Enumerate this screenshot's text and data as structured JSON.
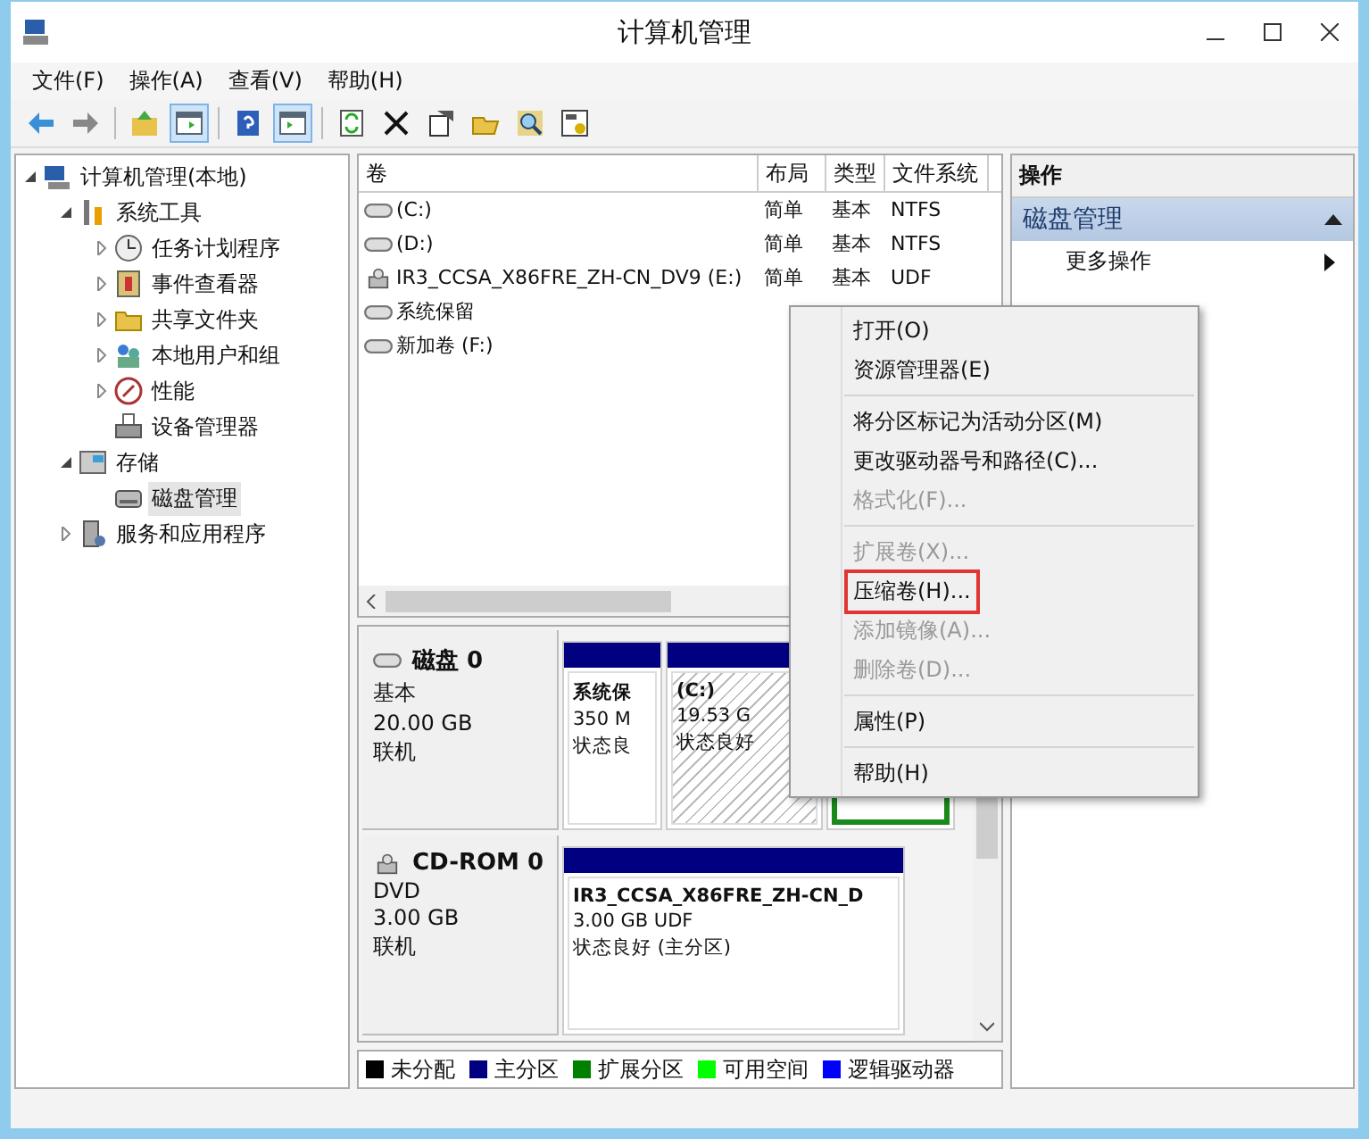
{
  "window": {
    "title": "计算机管理"
  },
  "menu_bar": [
    "文件(F)",
    "操作(A)",
    "查看(V)",
    "帮助(H)"
  ],
  "toolbar": [
    {
      "kind": "back"
    },
    {
      "kind": "forward"
    },
    {
      "kind": "separator"
    },
    {
      "kind": "up"
    },
    {
      "kind": "tree",
      "pressed": true
    },
    {
      "kind": "separator"
    },
    {
      "kind": "help"
    },
    {
      "kind": "pane",
      "pressed": true
    },
    {
      "kind": "separator"
    },
    {
      "kind": "refresh"
    },
    {
      "kind": "delete"
    },
    {
      "kind": "properties"
    },
    {
      "kind": "open"
    },
    {
      "kind": "find"
    },
    {
      "kind": "settings"
    }
  ],
  "tree": [
    {
      "label": "计算机管理(本地)",
      "kind": "computer",
      "expanded": true,
      "selected": false,
      "children": [
        {
          "label": "系统工具",
          "kind": "tools",
          "expanded": true,
          "selected": false,
          "children": [
            {
              "label": "任务计划程序",
              "kind": "clock",
              "expanded": false,
              "selected": false
            },
            {
              "label": "事件查看器",
              "kind": "log",
              "expanded": false,
              "selected": false
            },
            {
              "label": "共享文件夹",
              "kind": "folder",
              "expanded": false,
              "selected": false
            },
            {
              "label": "本地用户和组",
              "kind": "users",
              "expanded": false,
              "selected": false
            },
            {
              "label": "性能",
              "kind": "gauge",
              "expanded": false,
              "selected": false
            },
            {
              "label": "设备管理器",
              "kind": "device",
              "selected": false
            }
          ]
        },
        {
          "label": "存储",
          "kind": "storage",
          "expanded": true,
          "selected": false,
          "children": [
            {
              "label": "磁盘管理",
              "kind": "disk",
              "selected": true
            }
          ]
        },
        {
          "label": "服务和应用程序",
          "kind": "services",
          "expanded": false,
          "selected": false
        }
      ]
    }
  ],
  "volumes": {
    "columns": [
      "卷",
      "布局",
      "类型",
      "文件系统"
    ],
    "rows": [
      {
        "kind": "disk",
        "volume": "(C:)",
        "layout": "简单",
        "type": "基本",
        "file_system": "NTFS"
      },
      {
        "kind": "disk",
        "volume": "(D:)",
        "layout": "简单",
        "type": "基本",
        "file_system": "NTFS"
      },
      {
        "kind": "cd",
        "volume": "IR3_CCSA_X86FRE_ZH-CN_DV9 (E:)",
        "layout": "简单",
        "type": "基本",
        "file_system": "UDF"
      },
      {
        "kind": "disk",
        "volume": "系统保留"
      },
      {
        "kind": "disk",
        "volume": "新加卷 (F:)"
      }
    ]
  },
  "actions": {
    "title": "操作",
    "section": "磁盘管理",
    "expanded": true,
    "items": [
      "更多操作"
    ]
  },
  "disks": [
    {
      "kind": "disk",
      "name": "磁盘 0",
      "lines": [
        "基本",
        "20.00 GB",
        "联机"
      ],
      "partitions": [
        {
          "kind": "primary",
          "name": "系统保",
          "lines": [
            "350 M",
            "状态良"
          ],
          "selected": false
        },
        {
          "kind": "primary",
          "name": "(C:)",
          "lines": [
            "19.53 G",
            "状态良好"
          ],
          "selected": true
        },
        {
          "kind": "extended",
          "selected": false
        }
      ]
    },
    {
      "kind": "cd",
      "name": "CD-ROM 0",
      "lines": [
        "DVD",
        "3.00 GB",
        "联机"
      ],
      "partitions": [
        {
          "kind": "primary",
          "name": "IR3_CCSA_X86FRE_ZH-CN_D",
          "lines": [
            "3.00 GB UDF",
            "状态良好 (主分区)"
          ],
          "selected": false
        }
      ]
    }
  ],
  "legend": [
    {
      "label": "未分配",
      "color": "#000000"
    },
    {
      "label": "主分区",
      "color": "#000080"
    },
    {
      "label": "扩展分区",
      "color": "#008000"
    },
    {
      "label": "可用空间",
      "color": "#00ff00"
    },
    {
      "label": "逻辑驱动器",
      "color": "#0000ff"
    }
  ],
  "context_menu": [
    {
      "kind": "item",
      "label": "打开(O)",
      "disabled": false,
      "highlighted": false
    },
    {
      "kind": "item",
      "label": "资源管理器(E)",
      "disabled": false,
      "highlighted": false
    },
    {
      "kind": "separator"
    },
    {
      "kind": "item",
      "label": "将分区标记为活动分区(M)",
      "disabled": false,
      "highlighted": false
    },
    {
      "kind": "item",
      "label": "更改驱动器号和路径(C)...",
      "disabled": false,
      "highlighted": false
    },
    {
      "kind": "item",
      "label": "格式化(F)...",
      "disabled": true,
      "highlighted": false
    },
    {
      "kind": "separator"
    },
    {
      "kind": "item",
      "label": "扩展卷(X)...",
      "disabled": true,
      "highlighted": false
    },
    {
      "kind": "item",
      "label": "压缩卷(H)...",
      "disabled": false,
      "highlighted": true
    },
    {
      "kind": "item",
      "label": "添加镜像(A)...",
      "disabled": true,
      "highlighted": false
    },
    {
      "kind": "item",
      "label": "删除卷(D)...",
      "disabled": true,
      "highlighted": false
    },
    {
      "kind": "separator"
    },
    {
      "kind": "item",
      "label": "属性(P)",
      "disabled": false,
      "highlighted": false
    },
    {
      "kind": "separator"
    },
    {
      "kind": "item",
      "label": "帮助(H)",
      "disabled": false,
      "highlighted": false
    }
  ]
}
